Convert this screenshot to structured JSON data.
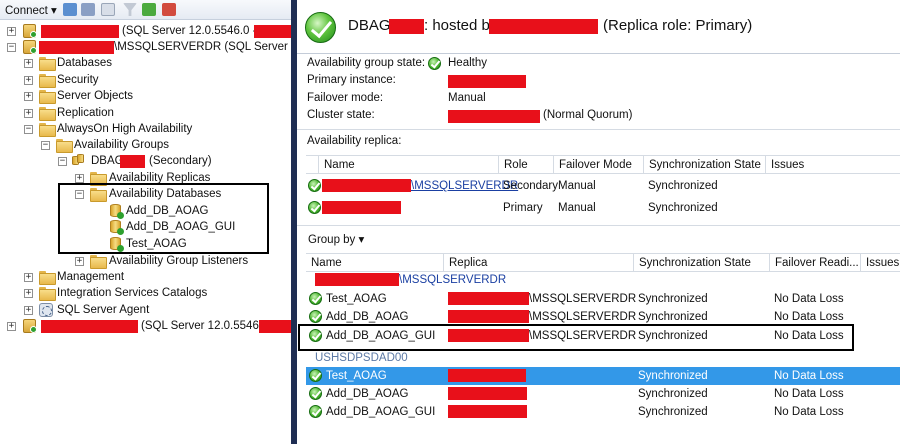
{
  "toolbar": {
    "connect_label": "Connect ▾",
    "buttons": [
      "connect-object-icon",
      "disconnect-icon",
      "stop-icon",
      "filter-icon",
      "refresh-icon",
      "activity-monitor-icon"
    ]
  },
  "tree": {
    "server1_suffix": "(SQL Server 12.0.5546.0 -",
    "server2_suffix": "\\MSSQLSERVERDR (SQL Server 12.0",
    "databases": "Databases",
    "security": "Security",
    "server_objects": "Server Objects",
    "replication": "Replication",
    "alwayson": "AlwaysOn High Availability",
    "availability_groups": "Availability Groups",
    "ag_name_prefix": "DBAG",
    "ag_role": "(Secondary)",
    "availability_replicas": "Availability Replicas",
    "availability_databases": "Availability Databases",
    "db_items": [
      "Add_DB_AOAG",
      "Add_DB_AOAG_GUI",
      "Test_AOAG"
    ],
    "ag_listeners": "Availability Group Listeners",
    "management": "Management",
    "integration_services": "Integration Services Catalogs",
    "sql_agent": "SQL Server Agent",
    "server3_suffix": "(SQL Server 12.0.5546.0 -"
  },
  "dashboard": {
    "title_prefix": "DBAG",
    "title_hosted": ": hosted by",
    "title_role": "(Replica role: Primary)",
    "props": {
      "state_label": "Availability group state:",
      "state_value": "Healthy",
      "primary_label": "Primary instance:",
      "failover_label": "Failover mode:",
      "failover_value": "Manual",
      "cluster_label": "Cluster state:",
      "cluster_value": "(Normal Quorum)"
    },
    "replica_section_label": "Availability replica:",
    "replica_columns": [
      "Name",
      "Role",
      "Failover Mode",
      "Synchronization State",
      "Issues"
    ],
    "replicas": [
      {
        "name_suffix": "\\MSSQLSERVERDR",
        "role": "Secondary",
        "failover": "Manual",
        "sync": "Synchronized"
      },
      {
        "name_suffix": "",
        "role": "Primary",
        "failover": "Manual",
        "sync": "Synchronized"
      }
    ],
    "group_by_label": "Group by ▾",
    "db_columns": [
      "Name",
      "Replica",
      "Synchronization State",
      "Failover Readi...",
      "Issues"
    ],
    "group1_label": "\\MSSQLSERVERDR",
    "group1_rows": [
      {
        "name": "Test_AOAG",
        "replica_suffix": "\\MSSQLSERVERDR",
        "sync": "Synchronized",
        "failover": "No Data Loss"
      },
      {
        "name": "Add_DB_AOAG",
        "replica_suffix": "\\MSSQLSERVERDR",
        "sync": "Synchronized",
        "failover": "No Data Loss"
      },
      {
        "name": "Add_DB_AOAG_GUI",
        "replica_suffix": "\\MSSQLSERVERDR",
        "sync": "Synchronized",
        "failover": "No Data Loss"
      }
    ],
    "group2_label": "USHSDPSDAD00",
    "group2_rows": [
      {
        "name": "Test_AOAG",
        "sync": "Synchronized",
        "failover": "No Data Loss"
      },
      {
        "name": "Add_DB_AOAG",
        "sync": "Synchronized",
        "failover": "No Data Loss"
      },
      {
        "name": "Add_DB_AOAG_GUI",
        "sync": "Synchronized",
        "failover": "No Data Loss"
      }
    ]
  },
  "colors": {
    "redaction": "#e8101a",
    "selection": "#3398e8",
    "divider": "#1f2e53"
  }
}
